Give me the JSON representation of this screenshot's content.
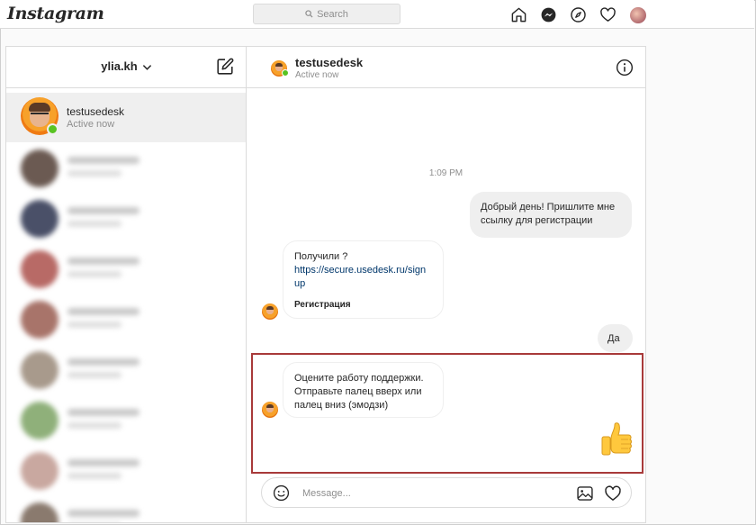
{
  "topnav": {
    "logo": "Instagram",
    "search_placeholder": "Search",
    "icons": [
      "home-icon",
      "messenger-icon",
      "explore-icon",
      "heart-icon",
      "profile-avatar"
    ]
  },
  "inbox": {
    "account": "ylia.kh",
    "active_thread": {
      "name": "testusedesk",
      "status": "Active now"
    }
  },
  "chat": {
    "header": {
      "name": "testusedesk",
      "status": "Active now"
    },
    "timestamp": "1:09 PM",
    "messages": [
      {
        "from": "me",
        "text": "Добрый день! Пришлите мне ссылку для регистрации"
      },
      {
        "from": "them",
        "text": "Получили ?",
        "link": "https://secure.usedesk.ru/sign up",
        "link_title": "Регистрация"
      },
      {
        "from": "me",
        "text": "Да"
      },
      {
        "from": "them",
        "text": "Оцените работу поддержки. Отправьте палец вверх или палец вниз (эмодзи)"
      },
      {
        "from": "me",
        "emoji": "thumbs-up"
      }
    ],
    "composer": {
      "placeholder": "Message..."
    }
  },
  "colors": {
    "online": "#58c322",
    "highlight_border": "#a83a3a",
    "link": "#00376b",
    "bubble_out": "#efefef"
  }
}
